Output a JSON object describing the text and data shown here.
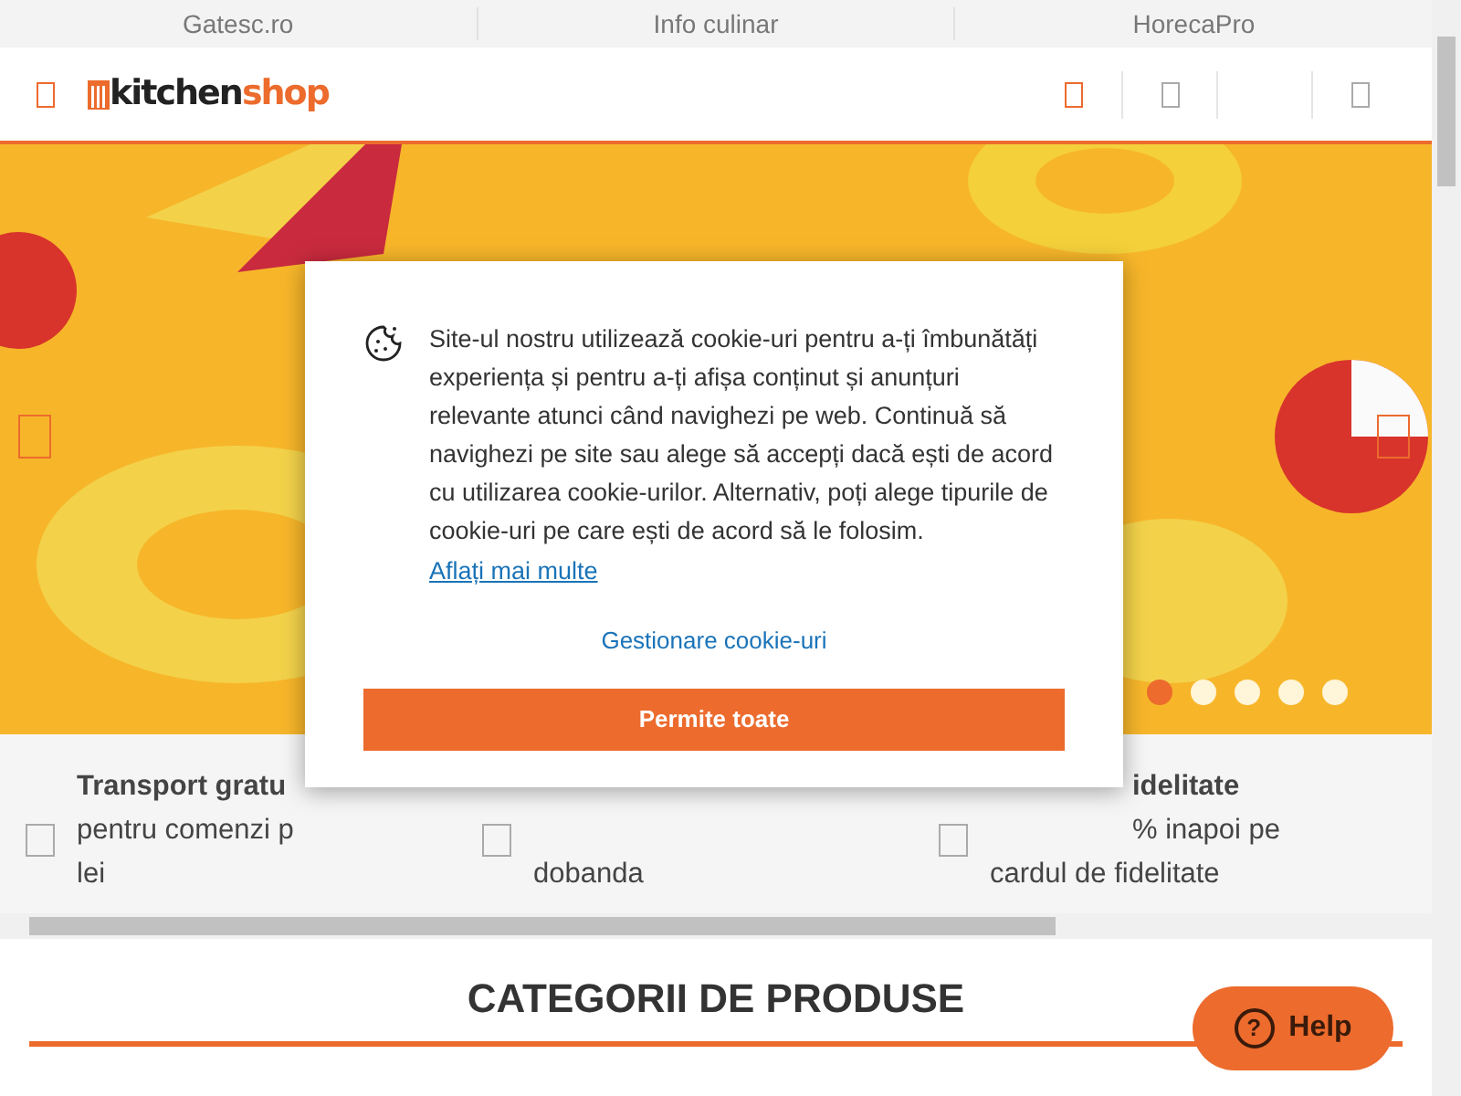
{
  "top_links": [
    {
      "label": "Gatesc.ro"
    },
    {
      "label": "Info culinar"
    },
    {
      "label": "HorecaPro"
    }
  ],
  "logo": {
    "part_1": "kitchen",
    "part_2": "shop"
  },
  "carousel": {
    "dots": [
      {
        "selected": true
      },
      {
        "selected": false
      },
      {
        "selected": false
      },
      {
        "selected": false
      },
      {
        "selected": false
      }
    ]
  },
  "features": [
    {
      "title": "Transport gratu",
      "lines": [
        "pentru comenzi p",
        "lei"
      ]
    },
    {
      "lines": [
        "dobanda"
      ]
    },
    {
      "title": "idelitate",
      "lines": [
        "% inapoi pe",
        "cardul de fidelitate"
      ]
    }
  ],
  "section_title": "CATEGORII DE PRODUSE",
  "cookie_dialog": {
    "text": "Site-ul nostru utilizează cookie-uri pentru a-ți îmbunătăți experiența și pentru a-ți afișa conținut și anunțuri relevante atunci când navighezi pe web. Continuă să navighezi pe site sau alege să accepți dacă ești de acord cu utilizarea cookie-urilor. Alternativ, poți alege tipurile de cookie-uri pe care ești de acord să le folosim.",
    "link": "Aflați mai multe",
    "manage": "Gestionare cookie-uri",
    "accept": "Permite toate"
  },
  "help_button": {
    "icon": "?",
    "label": "Help"
  }
}
